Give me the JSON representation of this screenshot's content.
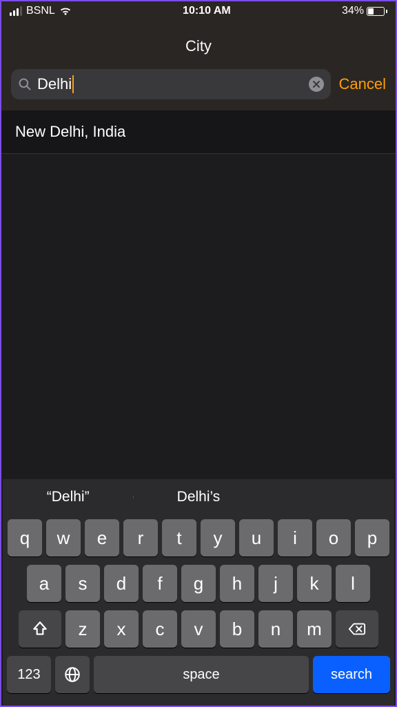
{
  "status": {
    "carrier": "BSNL",
    "time": "10:10 AM",
    "battery_pct": "34%"
  },
  "header": {
    "title": "City"
  },
  "search": {
    "value": "Delhi",
    "cancel_label": "Cancel"
  },
  "results": [
    {
      "label": "New Delhi, India"
    }
  ],
  "suggestions": [
    "“Delhi”",
    "Delhi’s",
    ""
  ],
  "keyboard": {
    "row1": [
      "q",
      "w",
      "e",
      "r",
      "t",
      "y",
      "u",
      "i",
      "o",
      "p"
    ],
    "row2": [
      "a",
      "s",
      "d",
      "f",
      "g",
      "h",
      "j",
      "k",
      "l"
    ],
    "row3": [
      "z",
      "x",
      "c",
      "v",
      "b",
      "n",
      "m"
    ],
    "num_label": "123",
    "space_label": "space",
    "search_label": "search"
  }
}
